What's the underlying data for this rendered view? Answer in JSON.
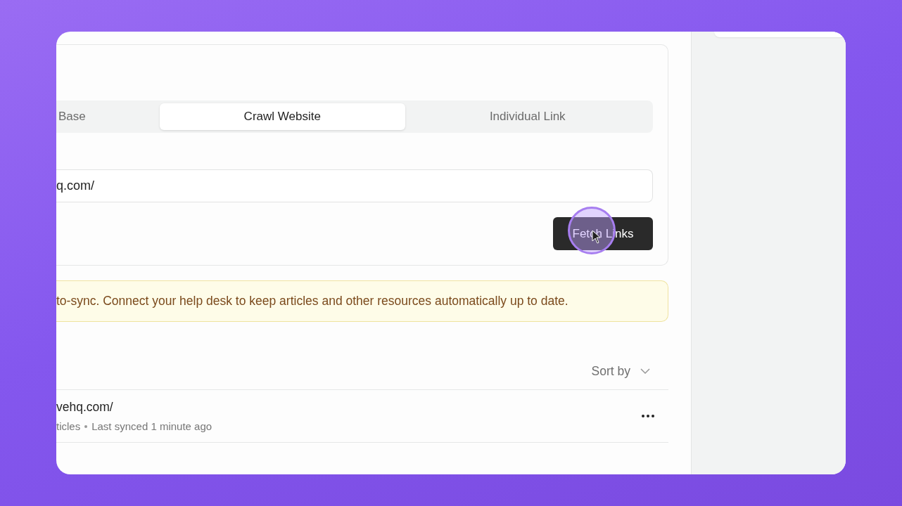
{
  "tabs": [
    {
      "label": "Base",
      "selected": false
    },
    {
      "label": "Crawl Website",
      "selected": true
    },
    {
      "label": "Individual Link",
      "selected": false
    }
  ],
  "url_field": {
    "value": "q.com/"
  },
  "fetch_button": {
    "label": "Fetch Links"
  },
  "notice": "to-sync. Connect your help desk to keep articles and other resources automatically up to date.",
  "sort": {
    "label": "Sort by"
  },
  "sources": [
    {
      "title": "vehq.com/",
      "meta": [
        "ticles",
        "Last synced 1 minute ago"
      ]
    }
  ]
}
